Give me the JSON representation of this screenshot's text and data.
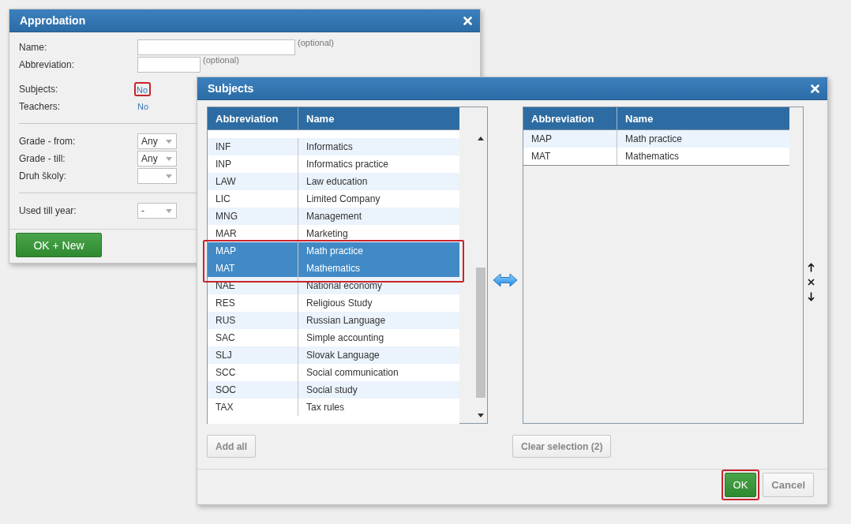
{
  "approbation_dialog": {
    "title": "Approbation",
    "sections": [
      {
        "groups": [
          [
            {
              "kind": "wide_input",
              "label": "Name:",
              "hint": "(optional)"
            },
            {
              "kind": "narrow_input",
              "label": "Abbreviation:",
              "hint": "(optional)"
            }
          ],
          [
            {
              "kind": "link",
              "label": "Subjects:",
              "value": "No",
              "highlighted": true
            },
            {
              "kind": "link",
              "label": "Teachers:",
              "value": "No"
            }
          ]
        ]
      },
      {
        "groups": [
          [
            {
              "kind": "select",
              "label": "Grade - from:",
              "value": "Any"
            },
            {
              "kind": "select",
              "label": "Grade - till:",
              "value": "Any"
            },
            {
              "kind": "select",
              "label": "Druh školy:"
            }
          ]
        ]
      },
      {
        "groups": [
          [
            {
              "kind": "select",
              "label": "Used till year:",
              "value": "-"
            }
          ]
        ]
      }
    ],
    "buttons": [
      {
        "label": "OK + New",
        "kind": "primary"
      }
    ]
  },
  "subjects_dialog": {
    "title": "Subjects",
    "available": {
      "columns": [
        "Abbreviation",
        "Name"
      ],
      "selection_highlighted": true,
      "rows": [
        {
          "abbreviation": "INF",
          "name": "Informatics",
          "selected": false
        },
        {
          "abbreviation": "INP",
          "name": "Informatics practice",
          "selected": false
        },
        {
          "abbreviation": "LAW",
          "name": "Law education",
          "selected": false
        },
        {
          "abbreviation": "LIC",
          "name": "Limited Company",
          "selected": false
        },
        {
          "abbreviation": "MNG",
          "name": "Management",
          "selected": false
        },
        {
          "abbreviation": "MAR",
          "name": "Marketing",
          "selected": false
        },
        {
          "abbreviation": "MAP",
          "name": "Math practice",
          "selected": true
        },
        {
          "abbreviation": "MAT",
          "name": "Mathematics",
          "selected": true
        },
        {
          "abbreviation": "NAE",
          "name": "National economy",
          "selected": false
        },
        {
          "abbreviation": "RES",
          "name": "Religious Study",
          "selected": false
        },
        {
          "abbreviation": "RUS",
          "name": "Russian Language",
          "selected": false
        },
        {
          "abbreviation": "SAC",
          "name": "Simple accounting",
          "selected": false
        },
        {
          "abbreviation": "SLJ",
          "name": "Slovak Language",
          "selected": false
        },
        {
          "abbreviation": "SCC",
          "name": "Social communication",
          "selected": false
        },
        {
          "abbreviation": "SOC",
          "name": "Social study",
          "selected": false
        },
        {
          "abbreviation": "TAX",
          "name": "Tax rules",
          "selected": false
        }
      ]
    },
    "chosen": {
      "columns": [
        "Abbreviation",
        "Name"
      ],
      "rows": [
        {
          "abbreviation": "MAP",
          "name": "Math practice"
        },
        {
          "abbreviation": "MAT",
          "name": "Mathematics"
        }
      ]
    },
    "add_all_button": "Add all",
    "clear_button": "Clear selection (2)",
    "buttons": [
      {
        "label": "OK",
        "kind": "primary",
        "highlighted": true
      },
      {
        "label": "Cancel",
        "kind": "secondary"
      }
    ]
  }
}
